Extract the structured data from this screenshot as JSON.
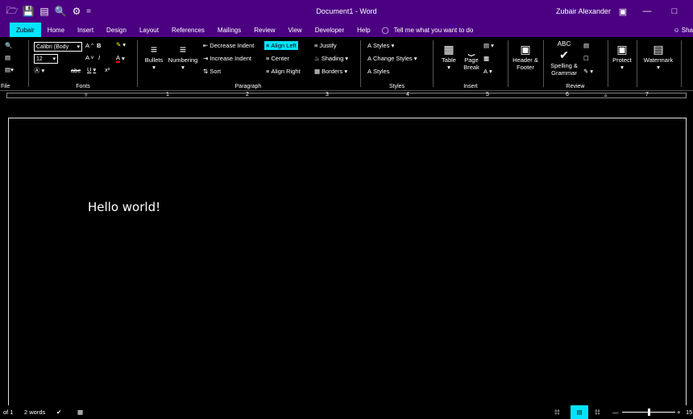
{
  "titlebar": {
    "document_title": "Document1 - Word",
    "user": "Zubair Alexander",
    "qat_separator": "="
  },
  "tabs": {
    "items": [
      "Zubair",
      "Home",
      "Insert",
      "Design",
      "Layout",
      "References",
      "Mailings",
      "Review",
      "View",
      "Developer",
      "Help"
    ],
    "active": "Zubair",
    "tell_me": "Tell me what you want to do",
    "share": "Sha"
  },
  "ribbon": {
    "file_group": {
      "label": "File"
    },
    "fonts_group": {
      "label": "Fonts",
      "font_name": "Calibri (Body",
      "font_size": "12",
      "bold": "B",
      "italic": "I",
      "underline": "U",
      "strikethrough": "abc",
      "grow": "A",
      "shrink": "A",
      "font_color": "A",
      "superscript": "x²"
    },
    "paragraph_group": {
      "label": "Paragraph",
      "bullets": "Bullets",
      "numbering": "Numbering",
      "decrease_indent": "Decrease Indent",
      "increase_indent": "Increase Indent",
      "sort": "Sort",
      "align_left": "Align Left",
      "center": "Center",
      "align_right": "Align Right",
      "justify": "Justify",
      "shading": "Shading",
      "borders": "Borders"
    },
    "styles_group": {
      "label": "Styles",
      "styles1": "Styles",
      "change_styles": "Change Styles",
      "styles2": "Styles"
    },
    "insert_group": {
      "label": "Insert",
      "table": "Table",
      "page_break_1": "Page",
      "page_break_2": "Break"
    },
    "header_footer": {
      "line1": "Header &",
      "line2": "Footer"
    },
    "review_group": {
      "label": "Review",
      "spelling_1": "Spelling &",
      "spelling_2": "Grammar",
      "abc": "ABC"
    },
    "protect": "Protect",
    "watermark": "Watermark"
  },
  "ruler": {
    "numbers": [
      "1",
      "2",
      "3",
      "4",
      "5",
      "6",
      "7"
    ]
  },
  "document": {
    "text": "Hello world!"
  },
  "statusbar": {
    "page": "of 1",
    "words": "2 words",
    "zoom_end": "15"
  },
  "colors": {
    "title_bg": "#4b0082",
    "accent": "#00e5ff",
    "background": "#000000"
  }
}
